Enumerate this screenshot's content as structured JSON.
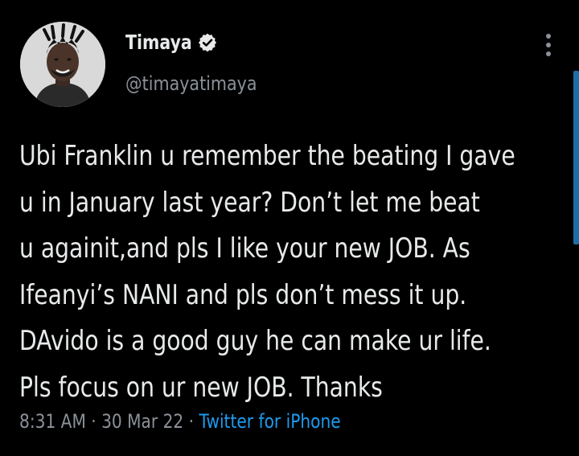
{
  "author": {
    "display_name": "Timaya",
    "handle": "@timayatimaya",
    "verified": true
  },
  "tweet": {
    "text": "Ubi Franklin u remember the beating I gave\nu in January last year?  Don’t let me beat\nu againit,and pls I like your new JOB. As\nIfeanyi’s NANI and pls don’t mess it up.\nDAvido is a good guy he can make ur life.\nPls focus on ur new JOB. Thanks"
  },
  "meta": {
    "time": "8:31 AM",
    "separator1": " · ",
    "date": "30 Mar 22",
    "separator2": " · ",
    "source": "Twitter for iPhone"
  },
  "icons": {
    "verified": "verified-badge-icon",
    "more": "more-vertical-icon"
  },
  "colors": {
    "background": "#000000",
    "text": "#e7e9ea",
    "secondary": "#8b9198",
    "link": "#1d9bf0",
    "scrollbar": "#1e6fa8"
  }
}
